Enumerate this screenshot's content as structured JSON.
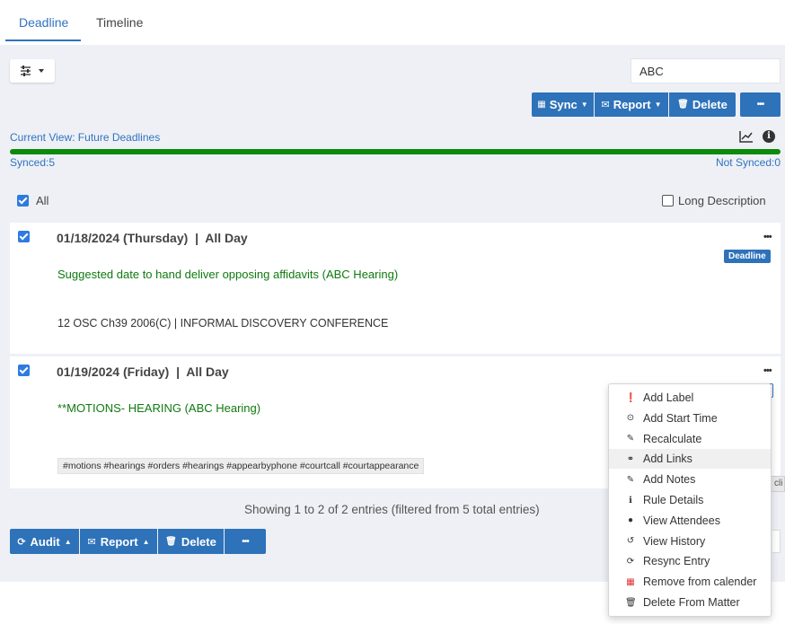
{
  "tabs": [
    {
      "label": "Deadline",
      "active": true
    },
    {
      "label": "Timeline",
      "active": false
    }
  ],
  "search": {
    "value": "ABC"
  },
  "toolbar": {
    "sync_label": "Sync",
    "report_label": "Report",
    "delete_label": "Delete",
    "more_label": "•••"
  },
  "status": {
    "current_view": "Current View: Future Deadlines",
    "synced": "Synced:5",
    "not_synced": "Not Synced:0",
    "progress": 1.0,
    "progress_color": "#0b8a0b"
  },
  "selection": {
    "all_label": "All",
    "all_checked": true,
    "long_description_label": "Long Description",
    "long_description_checked": false
  },
  "entries": [
    {
      "checked": true,
      "date": "01/18/2024 (Thursday)  |  All Day",
      "title": "Suggested date to hand deliver opposing affidavits (ABC Hearing)",
      "rule": "12 OSC Ch39 2006(C) | INFORMAL DISCOVERY CONFERENCE",
      "badge": "Deadline",
      "more": "•••"
    },
    {
      "checked": true,
      "date": "01/19/2024 (Friday)  |  All Day",
      "title": "**MOTIONS- HEARING (ABC Hearing)",
      "tags": "#motions #hearings #orders #hearings #appearbyphone #courtcall #courtappearance",
      "more": "•••"
    }
  ],
  "footer": {
    "showing": "Showing 1 to 2 of 2 entries (filtered from 5 total entries)",
    "audit_label": "Audit",
    "report_label": "Report",
    "delete_label": "Delete",
    "more_label": "•••"
  },
  "tooltip_text": "cli",
  "context_menu": {
    "items": [
      {
        "label": "Add Label",
        "icon": "pin-icon",
        "glyph": "❗"
      },
      {
        "label": "Add Start Time",
        "icon": "clock-icon",
        "glyph": "⊙"
      },
      {
        "label": "Recalculate",
        "icon": "pencil-icon",
        "glyph": "✎"
      },
      {
        "label": "Add Links",
        "icon": "link-icon",
        "glyph": "⚭"
      },
      {
        "label": "Add Notes",
        "icon": "edit-icon",
        "glyph": "✎"
      },
      {
        "label": "Rule Details",
        "icon": "info-icon",
        "glyph": "ℹ"
      },
      {
        "label": "View Attendees",
        "icon": "user-icon",
        "glyph": "●"
      },
      {
        "label": "View History",
        "icon": "history-icon",
        "glyph": "↺"
      },
      {
        "label": "Resync Entry",
        "icon": "refresh-icon",
        "glyph": "⟳"
      },
      {
        "label": "Remove from calender",
        "icon": "calendar-remove-icon",
        "glyph": "▦"
      },
      {
        "label": "Delete From Matter",
        "icon": "trash-icon",
        "glyph": "🗑"
      }
    ],
    "active_item": "Add Links"
  },
  "colors": {
    "accent": "#2f73c0",
    "button": "#2e72b9",
    "title_green": "#0f7a0f",
    "danger_icon": "#dd3333"
  }
}
